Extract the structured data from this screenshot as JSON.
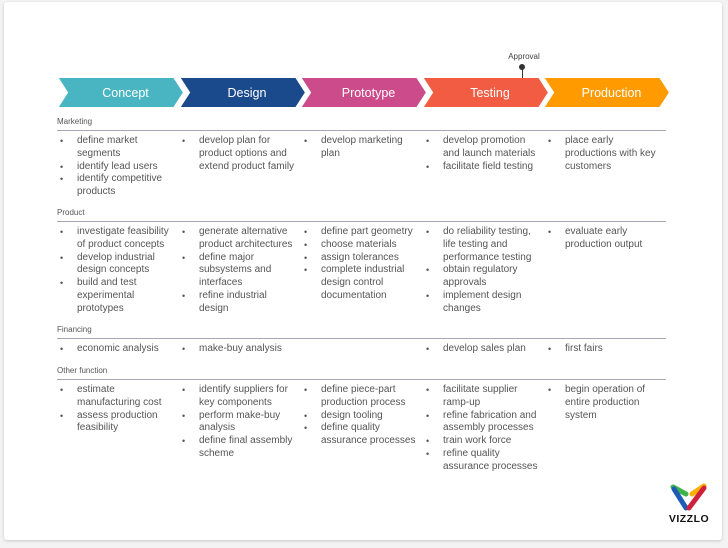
{
  "phases": [
    {
      "label": "Concept",
      "color": "#4ab5c2"
    },
    {
      "label": "Design",
      "color": "#1b4a8c"
    },
    {
      "label": "Prototype",
      "color": "#cc4b8a"
    },
    {
      "label": "Testing",
      "color": "#f25c43"
    },
    {
      "label": "Production",
      "color": "#ff9a00"
    }
  ],
  "milestone": {
    "label": "Approval"
  },
  "sections": [
    {
      "label": "Marketing",
      "columns": [
        [
          "define market segments",
          "identify lead users",
          "identify competitive products"
        ],
        [
          "develop plan for product options and extend product family"
        ],
        [
          "develop marketing plan"
        ],
        [
          "develop promotion and launch materials",
          "facilitate field testing"
        ],
        [
          "place early productions with key customers"
        ]
      ]
    },
    {
      "label": "Product",
      "columns": [
        [
          "investigate feasibility of product concepts",
          "develop industrial design concepts",
          "build and test experimental prototypes"
        ],
        [
          "generate alternative product architectures",
          "define major subsystems and interfaces",
          "refine industrial design"
        ],
        [
          "define part geometry",
          "choose materials",
          "assign tolerances",
          "complete industrial design control documentation"
        ],
        [
          "do reliability testing, life testing and performance testing",
          "obtain regulatory approvals",
          "implement design changes"
        ],
        [
          "evaluate early production output"
        ]
      ]
    },
    {
      "label": "Financing",
      "columns": [
        [
          "economic analysis"
        ],
        [
          "make-buy analysis"
        ],
        [],
        [
          "develop sales plan"
        ],
        [
          "first fairs"
        ]
      ]
    },
    {
      "label": "Other function",
      "columns": [
        [
          "estimate manufacturing cost",
          "assess production feasibility"
        ],
        [
          "identify suppliers for key components",
          "perform make-buy analysis",
          "define final assembly scheme"
        ],
        [
          "define piece-part production process",
          "design tooling",
          "define quality assurance processes"
        ],
        [
          "facilitate supplier ramp-up",
          "refine fabrication and assembly processes",
          "train work force",
          "refine quality assurance processes"
        ],
        [
          "begin operation of entire production system"
        ]
      ]
    }
  ],
  "logo": {
    "text": "VIZZLO",
    "colors": [
      "#3cb44a",
      "#ffb000",
      "#1e5bb8",
      "#d0203c"
    ]
  }
}
